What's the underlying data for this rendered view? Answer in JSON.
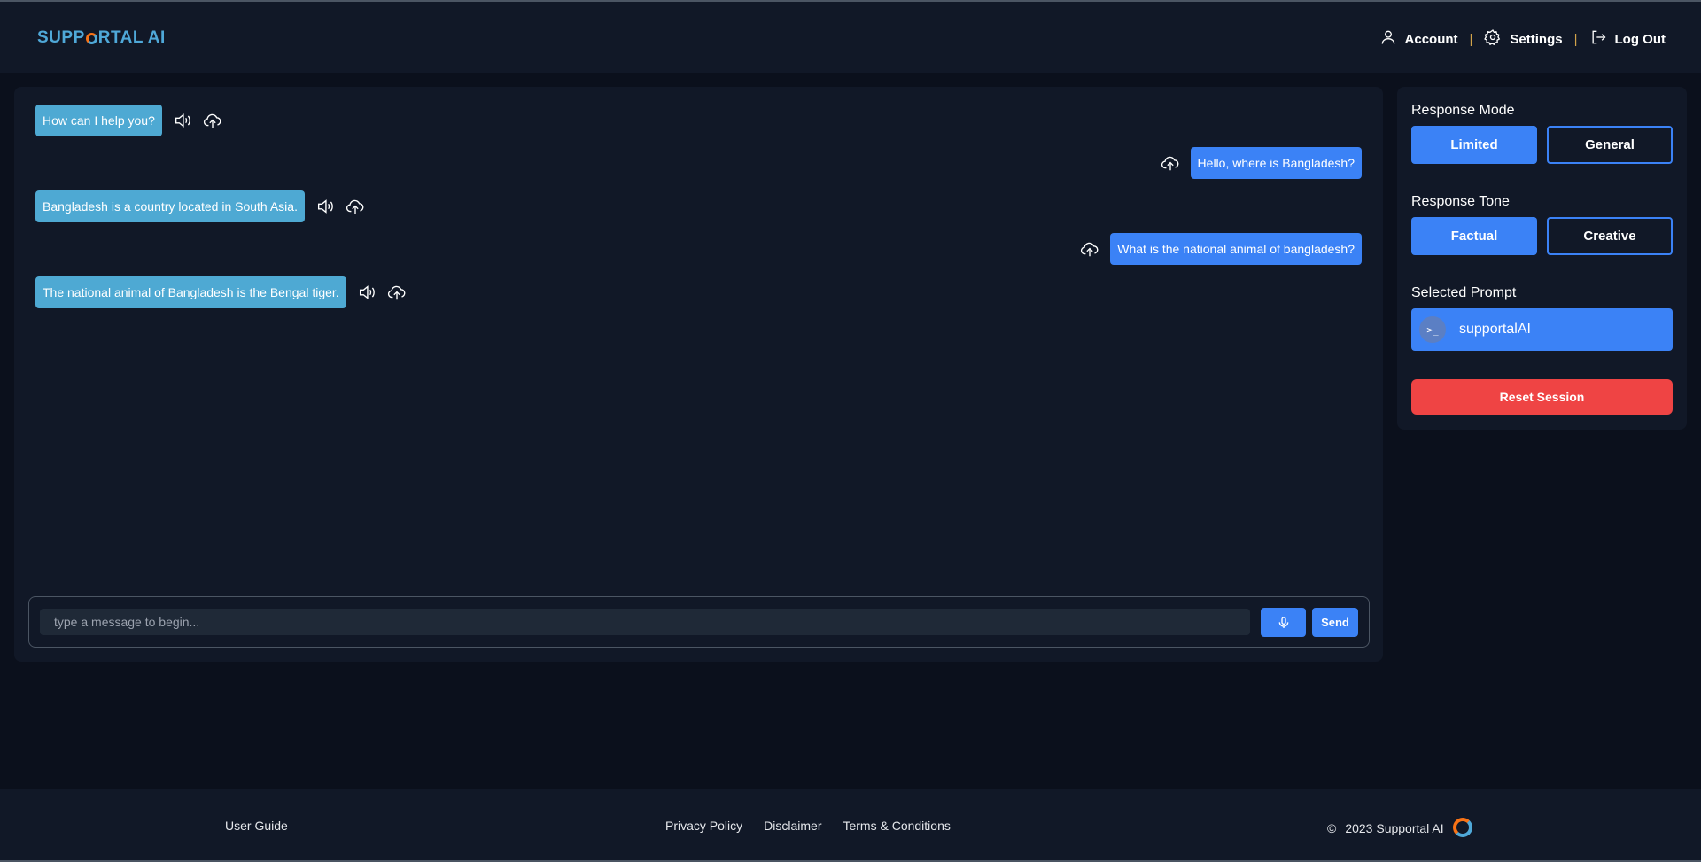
{
  "header": {
    "logo_text_before": "SUPP",
    "logo_text_after": "RTAL AI",
    "nav": {
      "account": "Account",
      "settings": "Settings",
      "logout": "Log Out",
      "separator": "|"
    }
  },
  "chat": {
    "messages": [
      {
        "role": "bot",
        "text": "How can I help you?"
      },
      {
        "role": "user",
        "text": "Hello, where is Bangladesh?"
      },
      {
        "role": "bot",
        "text": "Bangladesh is a country located in South Asia."
      },
      {
        "role": "user",
        "text": "What is the national animal of bangladesh?"
      },
      {
        "role": "bot",
        "text": "The national animal of Bangladesh is the Bengal tiger."
      }
    ],
    "input_placeholder": "type a message to begin...",
    "input_value": "",
    "send_label": "Send"
  },
  "sidebar": {
    "response_mode": {
      "heading": "Response Mode",
      "options": [
        "Limited",
        "General"
      ],
      "selected": "Limited"
    },
    "response_tone": {
      "heading": "Response Tone",
      "options": [
        "Factual",
        "Creative"
      ],
      "selected": "Factual"
    },
    "selected_prompt": {
      "heading": "Selected Prompt",
      "icon_glyph": ">_",
      "value": "supportalAI"
    },
    "reset_label": "Reset Session"
  },
  "footer": {
    "user_guide": "User Guide",
    "links": [
      "Privacy Policy",
      "Disclaimer",
      "Terms & Conditions"
    ],
    "copyright_symbol": "©",
    "copyright": "2023 Supportal AI"
  },
  "colors": {
    "background": "#0b101c",
    "panel": "#111827",
    "accent_blue": "#3b82f6",
    "bot_bubble": "#4ea9d3",
    "reset_red": "#ef4444",
    "logo_orange": "#f97316"
  },
  "icons": {
    "speaker": "speaker-icon",
    "upload": "cloud-upload-icon",
    "mic": "microphone-icon",
    "account": "user-icon",
    "settings": "gear-icon",
    "logout": "logout-icon",
    "prompt": "terminal-icon"
  }
}
